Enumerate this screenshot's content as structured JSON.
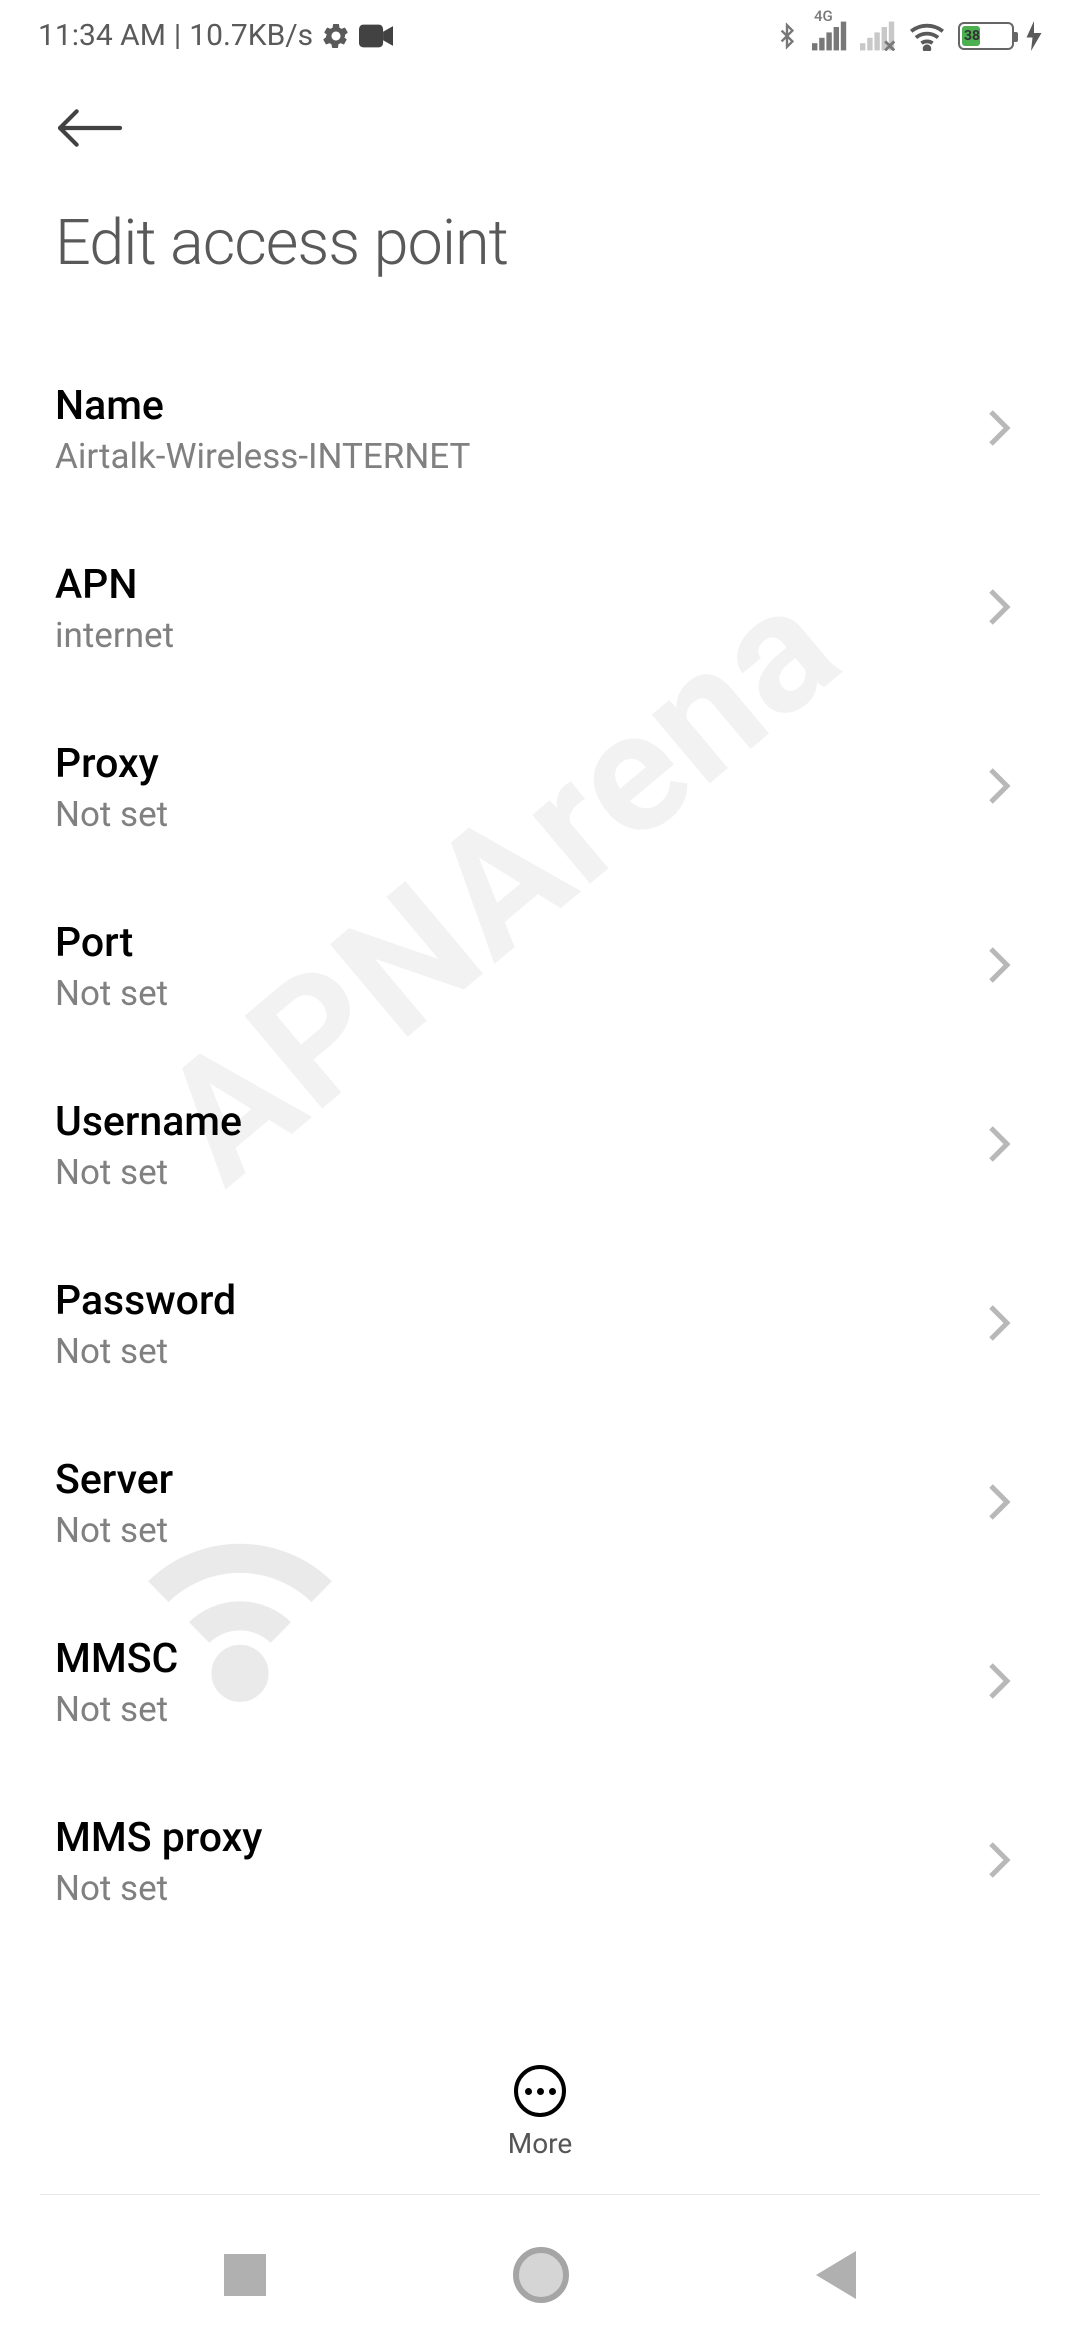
{
  "status": {
    "time": "11:34 AM",
    "separator": "|",
    "network_speed": "10.7KB/s",
    "battery_pct": "38",
    "network_badge": "4G"
  },
  "page_title": "Edit access point",
  "settings": [
    {
      "label": "Name",
      "value": "Airtalk-Wireless-INTERNET",
      "key": "name"
    },
    {
      "label": "APN",
      "value": "internet",
      "key": "apn"
    },
    {
      "label": "Proxy",
      "value": "Not set",
      "key": "proxy"
    },
    {
      "label": "Port",
      "value": "Not set",
      "key": "port"
    },
    {
      "label": "Username",
      "value": "Not set",
      "key": "username"
    },
    {
      "label": "Password",
      "value": "Not set",
      "key": "password"
    },
    {
      "label": "Server",
      "value": "Not set",
      "key": "server"
    },
    {
      "label": "MMSC",
      "value": "Not set",
      "key": "mmsc"
    },
    {
      "label": "MMS proxy",
      "value": "Not set",
      "key": "mms-proxy"
    }
  ],
  "bottom_action": {
    "label": "More"
  },
  "watermark": "APNArena"
}
